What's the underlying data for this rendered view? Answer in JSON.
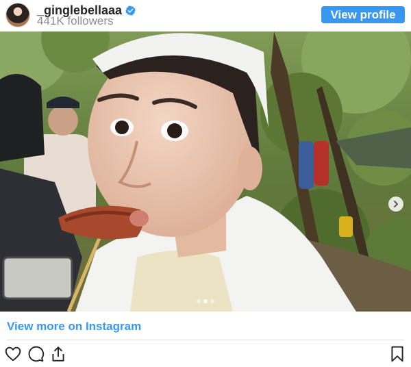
{
  "header": {
    "username": "_ginglebellaaa",
    "followers": "441K followers",
    "view_profile_label": "View profile"
  },
  "carousel": {
    "slides": 3,
    "active": 1
  },
  "footer": {
    "view_more_label": "View more on Instagram"
  },
  "colors": {
    "accent": "#3897f0",
    "verified": "#3897f0",
    "text": "#262626",
    "muted": "#8e8e8e",
    "divider": "#dbdbdb"
  },
  "icons": [
    "verified-badge-icon",
    "chevron-right-icon",
    "heart-icon",
    "comment-icon",
    "share-icon",
    "bookmark-icon"
  ]
}
